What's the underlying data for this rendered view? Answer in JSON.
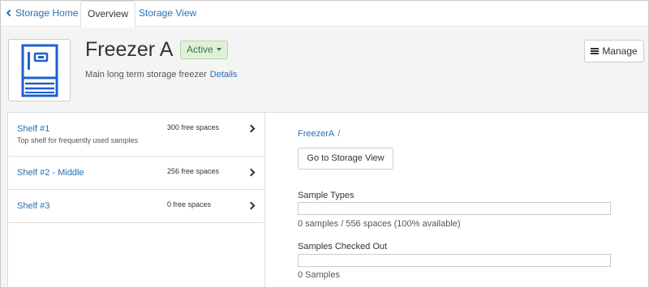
{
  "tabs": {
    "home": "Storage Home",
    "overview": "Overview",
    "storage_view": "Storage View"
  },
  "header": {
    "title": "Freezer A",
    "status": "Active",
    "description": "Main long term storage freezer",
    "details_link": "Details",
    "manage_button": "Manage",
    "icon": "freezer-icon"
  },
  "shelves": [
    {
      "name": "Shelf #1",
      "description": "Top shelf for frequently used samples",
      "free": "300 free spaces"
    },
    {
      "name": "Shelf #2 - Middle",
      "description": "",
      "free": "256 free spaces"
    },
    {
      "name": "Shelf #3",
      "description": "",
      "free": "0 free spaces"
    }
  ],
  "detail": {
    "breadcrumb": "FreezerA",
    "breadcrumb_sep": "/",
    "goto_button": "Go to Storage View",
    "sample_types_label": "Sample Types",
    "sample_types_fill": 0,
    "sample_types_note": "0 samples / 556 spaces (100% available)",
    "checked_out_label": "Samples Checked Out",
    "checked_out_fill": 0,
    "checked_out_note": "0 Samples"
  },
  "colors": {
    "link": "#2a6fb0",
    "active_bg": "#dff0d8",
    "active_text": "#3c763d",
    "freezer_blue": "#1f5fcf"
  }
}
